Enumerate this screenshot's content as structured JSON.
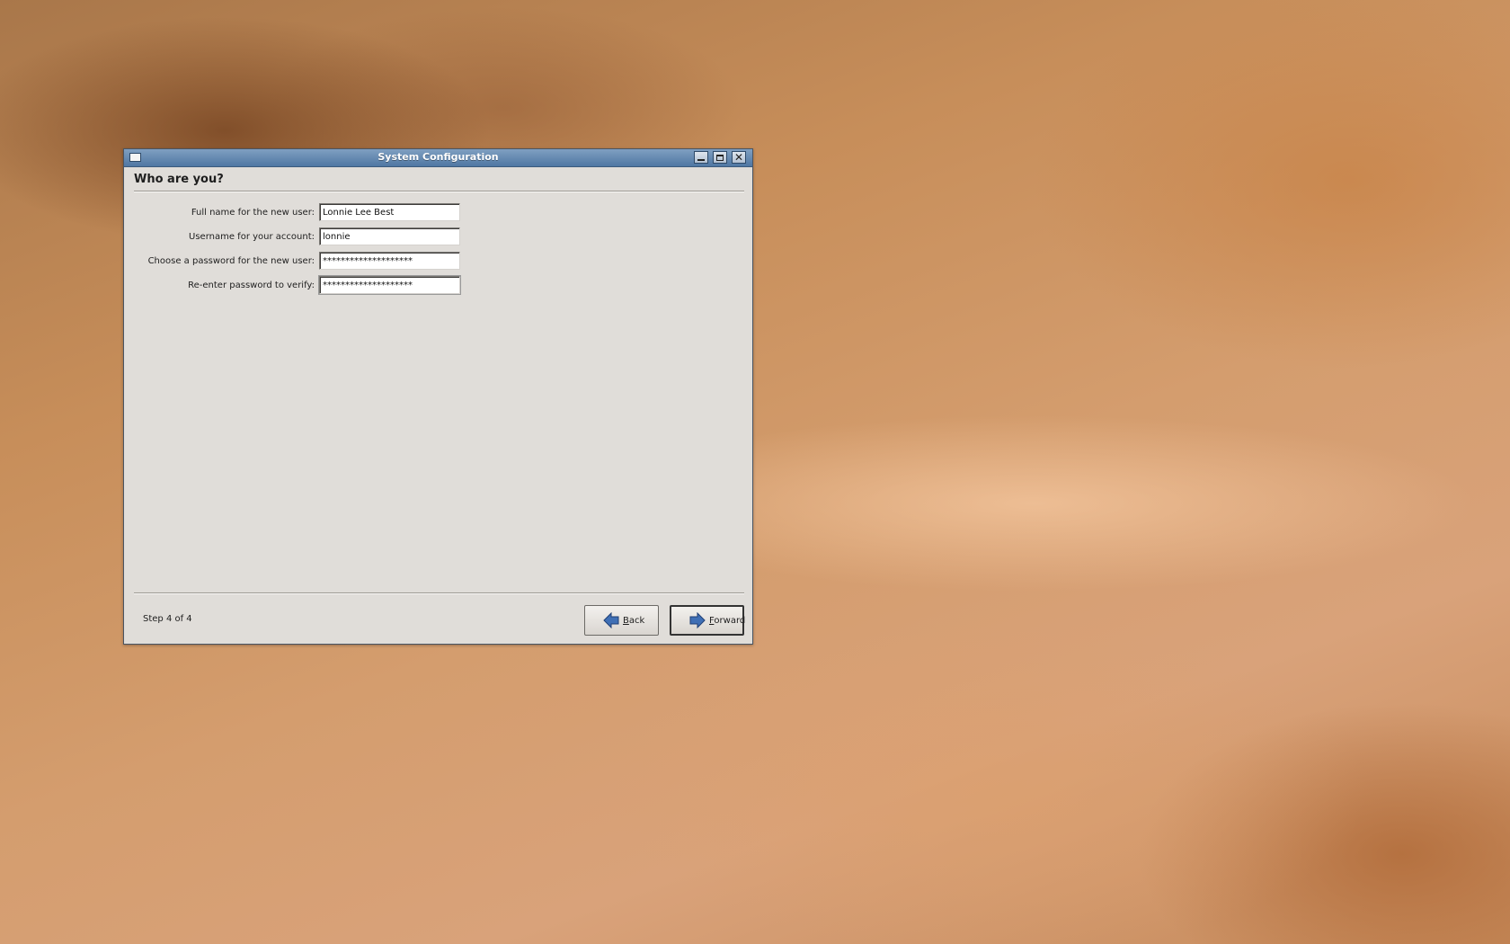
{
  "window": {
    "title": "System Configuration",
    "heading": "Who are you?",
    "controls": {
      "minimize_icon": "minimize-icon",
      "maximize_icon": "maximize-icon",
      "close_icon": "close-icon"
    }
  },
  "form": {
    "fields": [
      {
        "label": "Full name for the new user:",
        "value": "Lonnie Lee Best"
      },
      {
        "label": "Username for your account:",
        "value": "lonnie"
      },
      {
        "label": "Choose a password for the new user:",
        "value": "********************"
      },
      {
        "label": "Re-enter password to verify:",
        "value": "********************"
      }
    ]
  },
  "footer": {
    "step": "Step 4 of 4",
    "back": {
      "mnemonic": "B",
      "rest": "ack",
      "icon": "arrow-left-icon"
    },
    "forward": {
      "mnemonic": "F",
      "rest": "orward",
      "icon": "arrow-right-icon"
    }
  },
  "colors": {
    "titlebar": "#5d81ab",
    "window_bg": "#e0ddd9",
    "arrow_blue": "#3f6fb5"
  }
}
